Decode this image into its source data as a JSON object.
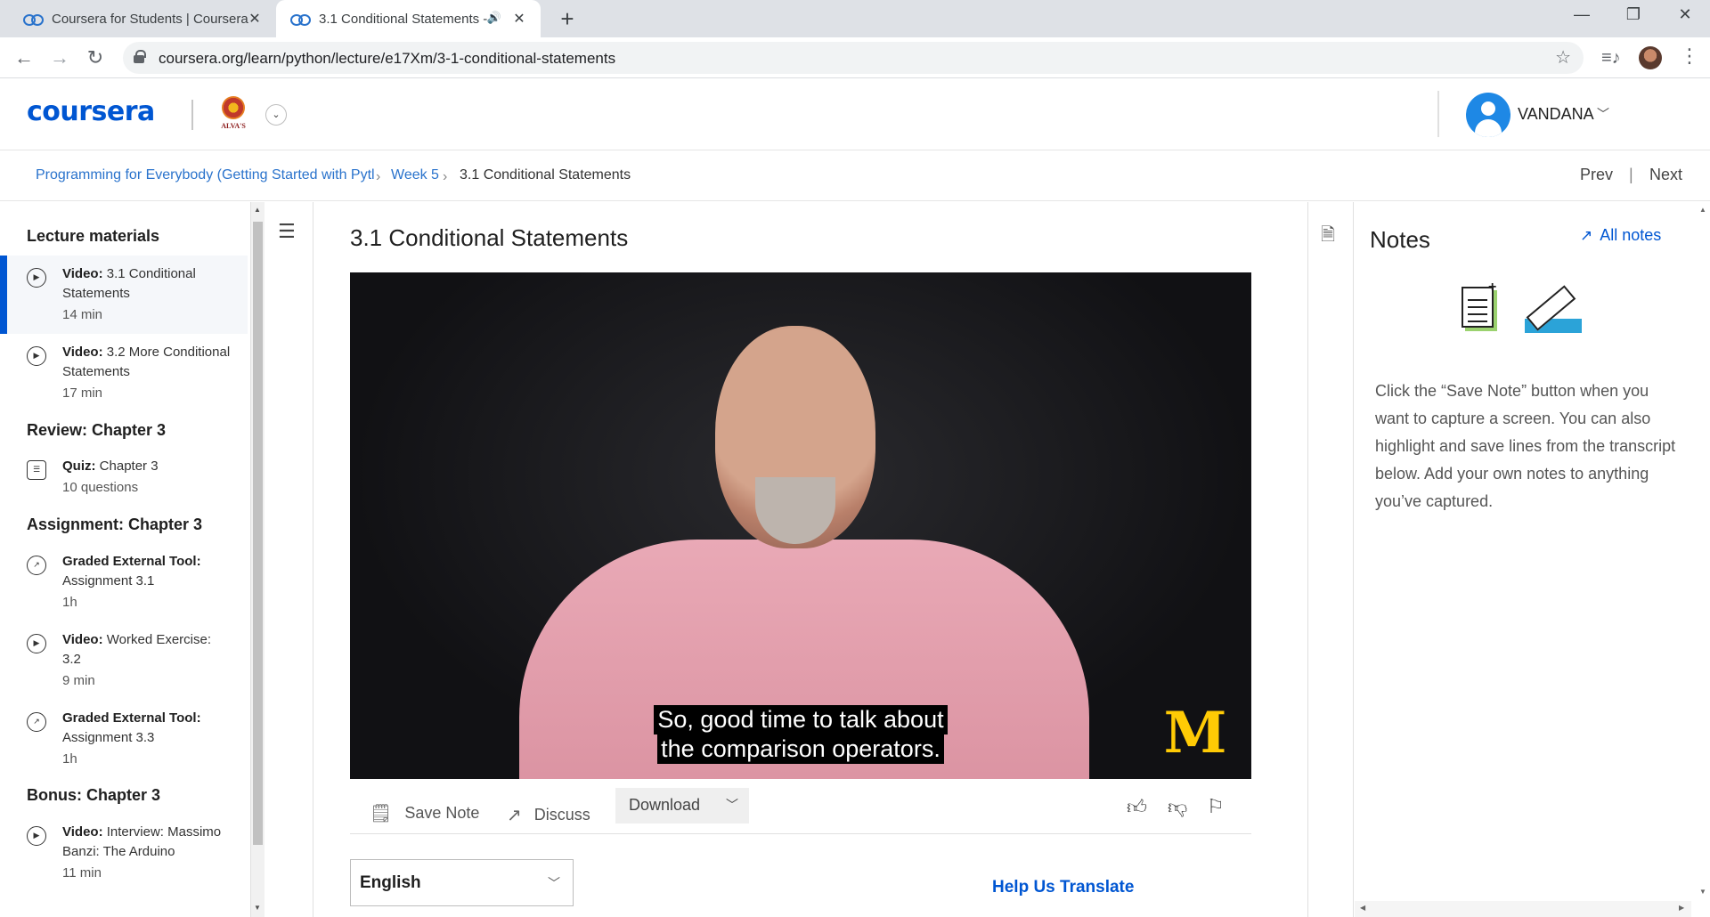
{
  "browser": {
    "tabs": [
      {
        "title": "Coursera for Students | Coursera"
      },
      {
        "title": "3.1 Conditional Statements -"
      }
    ],
    "url": "coursera.org/learn/python/lecture/e17Xm/3-1-conditional-statements"
  },
  "header": {
    "logo": "coursera",
    "partner_label": "ALVA'S",
    "user_name": "VANDANA"
  },
  "breadcrumb": {
    "course": "Programming for Everybody (Getting Started with Pytl",
    "week": "Week 5",
    "current": "3.1 Conditional Statements",
    "prev": "Prev",
    "next": "Next"
  },
  "sidebar": {
    "sections": [
      {
        "heading": "Lecture materials"
      },
      {
        "heading": "Review: Chapter 3"
      },
      {
        "heading": "Assignment: Chapter 3"
      },
      {
        "heading": "Bonus: Chapter 3"
      }
    ],
    "items": [
      {
        "type": "Video:",
        "title": "3.1 Conditional Statements",
        "meta": "14 min"
      },
      {
        "type": "Video:",
        "title": "3.2 More Conditional Statements",
        "meta": "17 min"
      },
      {
        "type": "Quiz:",
        "title": "Chapter 3",
        "meta": "10 questions"
      },
      {
        "type": "Graded External Tool:",
        "title": "Assignment 3.1",
        "meta": "1h"
      },
      {
        "type": "Video:",
        "title": "Worked Exercise: 3.2",
        "meta": "9 min"
      },
      {
        "type": "Graded External Tool:",
        "title": "Assignment 3.3",
        "meta": "1h"
      },
      {
        "type": "Video:",
        "title": "Interview: Massimo Banzi: The Arduino",
        "meta": "11 min"
      }
    ]
  },
  "main": {
    "title": "3.1 Conditional Statements",
    "caption_line1": "So, good time to talk about",
    "caption_line2": "the comparison operators.",
    "watermark": "M",
    "save_note": "Save Note",
    "discuss": "Discuss",
    "download": "Download",
    "language": "English",
    "help_translate": "Help Us Translate"
  },
  "notes": {
    "title": "Notes",
    "all_notes": "All notes",
    "description": "Click the “Save Note” button when you want to capture a screen. You can also highlight and save lines from the transcript below. Add your own notes to anything you’ve captured."
  },
  "colors": {
    "brand": "#0056d2",
    "link": "#2a73cc",
    "active_border": "#0056d2",
    "caption_bg": "#000000",
    "umich_gold": "#ffcb05"
  }
}
